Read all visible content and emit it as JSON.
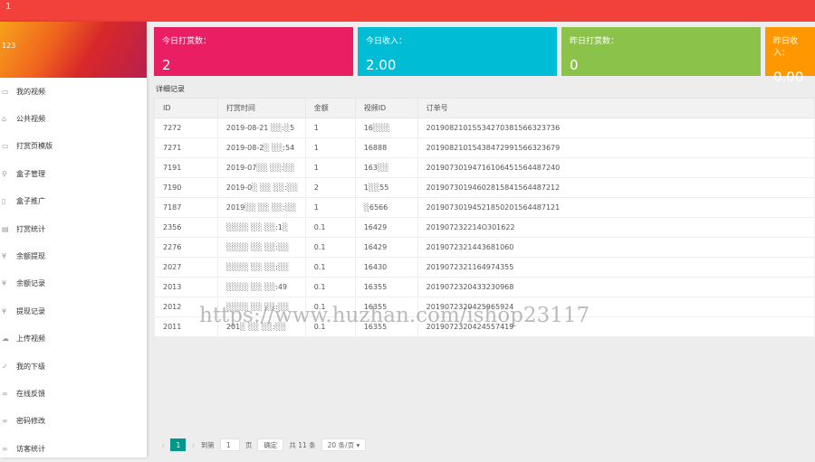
{
  "topbar": {
    "title": "1"
  },
  "sidebar": {
    "banner_text": "123",
    "items": [
      {
        "icon": "▭",
        "label": "我的视频"
      },
      {
        "icon": "⌂",
        "label": "公共视频"
      },
      {
        "icon": "▭",
        "label": "打赏页模版"
      },
      {
        "icon": "⚲",
        "label": "盒子管理"
      },
      {
        "icon": "▯",
        "label": "盒子推广"
      },
      {
        "icon": "▤",
        "label": "打赏统计"
      },
      {
        "icon": "¥",
        "label": "余额提现"
      },
      {
        "icon": "¥",
        "label": "余额记录"
      },
      {
        "icon": "¥",
        "label": "提现记录"
      },
      {
        "icon": "☁",
        "label": "上传视频"
      },
      {
        "icon": "✓",
        "label": "我的下级"
      },
      {
        "icon": "∞",
        "label": "在线反馈"
      },
      {
        "icon": "∞",
        "label": "密码修改"
      },
      {
        "icon": "∞",
        "label": "访客统计"
      }
    ]
  },
  "cards": [
    {
      "label": "今日打赏数：",
      "value": "2",
      "color": "#e91e63"
    },
    {
      "label": "今日收入：",
      "value": "2.00",
      "color": "#00bcd4"
    },
    {
      "label": "昨日打赏数：",
      "value": "0",
      "color": "#8bc34a"
    },
    {
      "label": "昨日收入：",
      "value": "0.00",
      "color": "#ff9800"
    }
  ],
  "section_title": "详细记录",
  "table": {
    "headers": [
      "ID",
      "打赏时间",
      "金额",
      "视频ID",
      "订单号"
    ],
    "rows": [
      [
        "7272",
        "2019-08-21 ░░:░5",
        "1",
        "16░░░",
        "20190821015534270381566323736"
      ],
      [
        "7271",
        "2019-08-2░ ░░:54",
        "1",
        "16888",
        "20190821015438472991566323679"
      ],
      [
        "7191",
        "2019-07░░ ░░:░░",
        "1",
        "163░░",
        "20190730194716106451564487240"
      ],
      [
        "7190",
        "2019-0░ ░░ ░░:░░",
        "2",
        "1░░55",
        "20190730194602815841564487212"
      ],
      [
        "7187",
        "2019░░ ░░ ░░:░░",
        "1",
        "░6566",
        "20190730194521850201564487121"
      ],
      [
        "2356",
        "░░░░ ░░ ░░:1░",
        "0.1",
        "16429",
        "201907232214O301622"
      ],
      [
        "2276",
        "░░░░ ░░ ░░:░░",
        "0.1",
        "16429",
        "2019072321443681060"
      ],
      [
        "2027",
        "░░░░ ░░ ░░:░░",
        "0.1",
        "16430",
        "2019072321164974355"
      ],
      [
        "2013",
        "░░░░ ░░ ░░:49",
        "0.1",
        "16355",
        "2019072320433230968"
      ],
      [
        "2012",
        "░░░░ ░░ ░░:░░",
        "0.1",
        "16355",
        "2019072320425965924"
      ],
      [
        "2011",
        "201░ ░░ ░░:░░",
        "0.1",
        "16355",
        "2019072320424557419"
      ]
    ]
  },
  "watermark": "https://www.huzhan.com/ishop23117",
  "pager": {
    "prev": "‹",
    "current": "1",
    "next": "›",
    "goto": "到第",
    "page_input": "1",
    "page_unit": "页",
    "confirm": "确定",
    "total": "共 11 条",
    "per_page": "20 条/页 ▾"
  }
}
